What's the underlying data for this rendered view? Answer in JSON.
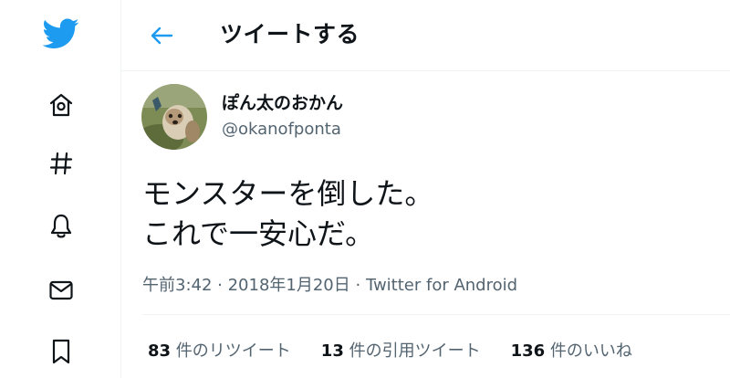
{
  "header": {
    "title": "ツイートする"
  },
  "tweet": {
    "display_name": "ぽん太のおかん",
    "handle": "@okanofponta",
    "text_lines": [
      "モンスターを倒した。",
      "これで一安心だ。"
    ],
    "time": "午前3:42",
    "date": "2018年1月20日",
    "separator": " · ",
    "source": "Twitter for Android"
  },
  "stats": {
    "retweets": {
      "count": "83",
      "label": " 件のリツイート"
    },
    "quotes": {
      "count": "13",
      "label": " 件の引用ツイート"
    },
    "likes": {
      "count": "136",
      "label": " 件のいいね"
    }
  },
  "icons": {
    "logo": "twitter-bird-icon",
    "home": "home-icon",
    "explore": "hashtag-icon",
    "notifications": "bell-icon",
    "messages": "envelope-icon",
    "bookmarks": "bookmark-icon",
    "back": "arrow-left-icon"
  },
  "colors": {
    "brand": "#1d9bf0",
    "text": "#0f1419",
    "secondary": "#536471"
  }
}
